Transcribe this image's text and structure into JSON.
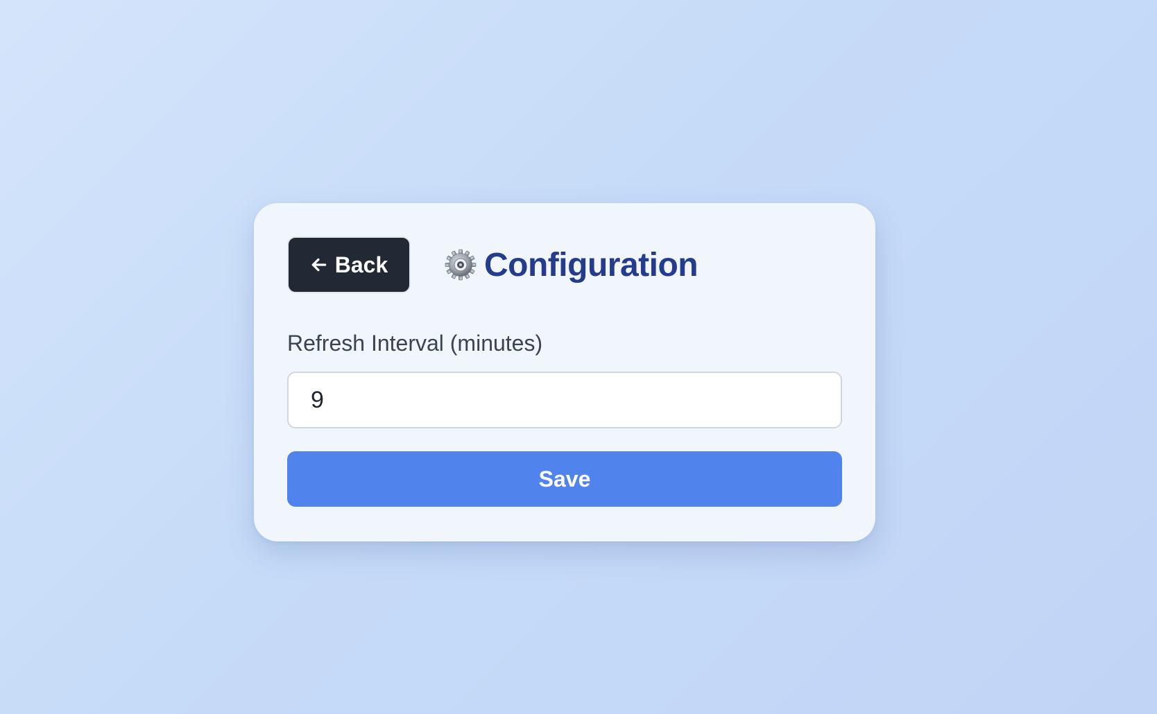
{
  "header": {
    "back_label": "Back",
    "title": "Configuration",
    "back_icon": "arrow-left-icon",
    "title_icon": "gear-icon"
  },
  "form": {
    "refresh_label": "Refresh Interval (minutes)",
    "refresh_value": "9",
    "save_label": "Save"
  },
  "colors": {
    "background": "#c6dbf8",
    "card": "#f1f6fd",
    "back_button": "#222834",
    "title": "#253c8c",
    "save_button": "#5083ec"
  }
}
